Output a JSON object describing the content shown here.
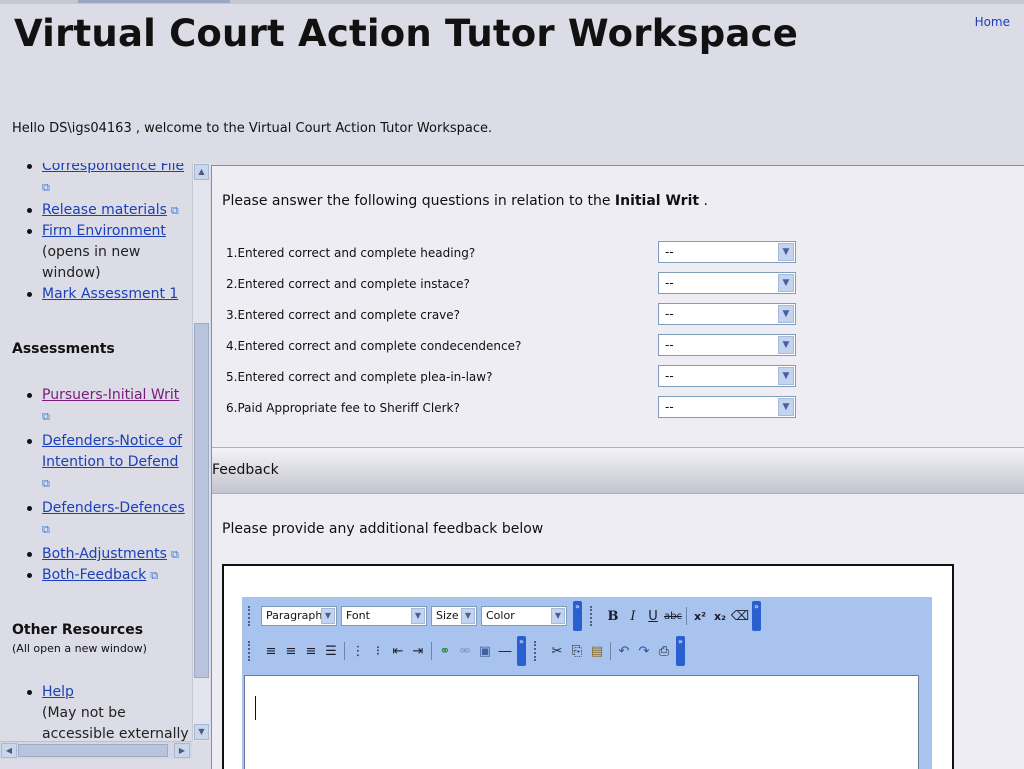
{
  "header": {
    "title": "Virtual Court Action Tutor Workspace",
    "home_link": "Home",
    "welcome": "Hello DS\\igs04163 , welcome to the Virtual Court Action Tutor Workspace."
  },
  "sidebar": {
    "top_items": [
      {
        "label": "Correspondence File"
      },
      {
        "label": "Release materials"
      },
      {
        "label": "Firm Environment",
        "note": "(opens in new window)"
      },
      {
        "label": "Mark Assessment 1"
      }
    ],
    "assessments_heading": "Assessments",
    "assessments": [
      {
        "label": "Pursuers-Initial Writ",
        "visited": true
      },
      {
        "label": "Defenders-Notice of Intention to Defend"
      },
      {
        "label": "Defenders-Defences"
      },
      {
        "label": "Both-Adjustments"
      },
      {
        "label": "Both-Feedback"
      }
    ],
    "other_heading": "Other Resources",
    "other_subheading": "(All open a new window)",
    "other_items": [
      {
        "label": "Help",
        "note": "(May not be accessible externally"
      }
    ],
    "icons": {
      "external": "new-window-icon",
      "scroll_up": "arrow-up-icon",
      "scroll_down": "arrow-down-icon",
      "scroll_left": "arrow-left-icon",
      "scroll_right": "arrow-right-icon"
    }
  },
  "main": {
    "intro_prefix": "Please answer the following questions in relation to the",
    "intro_doc": "Initial Writ",
    "intro_suffix": ".",
    "questions": [
      {
        "label": "1.Entered correct and complete heading?",
        "value": "--"
      },
      {
        "label": "2.Entered correct and complete instace?",
        "value": "--"
      },
      {
        "label": "3.Entered correct and complete crave?",
        "value": "--"
      },
      {
        "label": "4.Entered correct and complete condecendence?",
        "value": "--"
      },
      {
        "label": "5.Entered correct and complete plea-in-law?",
        "value": "--"
      },
      {
        "label": "6.Paid Appropriate fee to Sheriff Clerk?",
        "value": "--"
      }
    ],
    "feedback_label": "Feedback",
    "feedback_prompt": "Please provide any additional feedback below"
  },
  "editor": {
    "format_select": "Paragraph",
    "font_select": "Font",
    "size_select": "Size",
    "color_select": "Color",
    "bold": "B",
    "italic": "I",
    "underline": "U",
    "strike": "abc",
    "superscript": "x²",
    "subscript": "x₂",
    "more_glyph": "»",
    "content": ""
  },
  "colors": {
    "page_bg": "#dcdce6",
    "link": "#1a3fb8",
    "link_visited": "#7a1a7a",
    "toolbar_bg": "#a8c4ee"
  }
}
